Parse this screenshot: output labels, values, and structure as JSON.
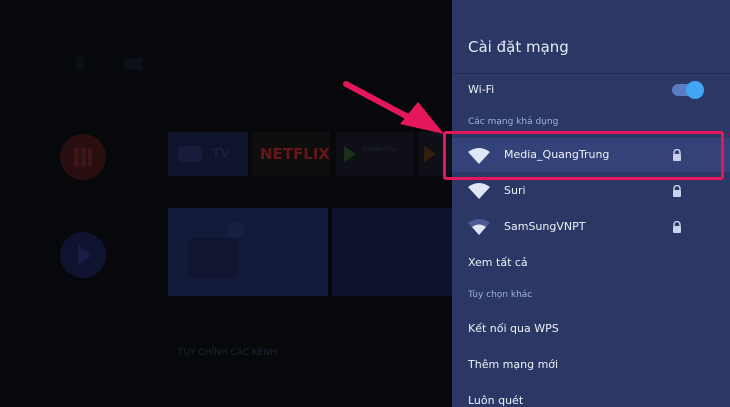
{
  "background_home": {
    "tile_netflix": "NETFLIX",
    "tile_tv": "TV",
    "tile_google_play": "Google Play",
    "bottom_label": "TÙY CHỈNH CÁC KÊNH"
  },
  "panel": {
    "title": "Cài đặt mạng",
    "wifi_label": "Wi-Fi",
    "wifi_enabled": true,
    "available_section": "Các mạng khả dụng",
    "networks": [
      {
        "name": "Media_QuangTrung",
        "locked": true,
        "icon": "wifi-icon"
      },
      {
        "name": "Suri",
        "locked": true,
        "icon": "wifi-icon"
      },
      {
        "name": "SamSungVNPT",
        "locked": true,
        "icon": "wifi-icon"
      }
    ],
    "see_all": "Xem tất cả",
    "other_section": "Tùy chọn khác",
    "wps": "Kết nối qua WPS",
    "add_network": "Thêm mạng mới",
    "always_scan": "Luôn quét"
  },
  "colors": {
    "panel_bg": "#2b3866",
    "highlight": "#e5165a",
    "toggle_knob": "#42a5f5"
  }
}
